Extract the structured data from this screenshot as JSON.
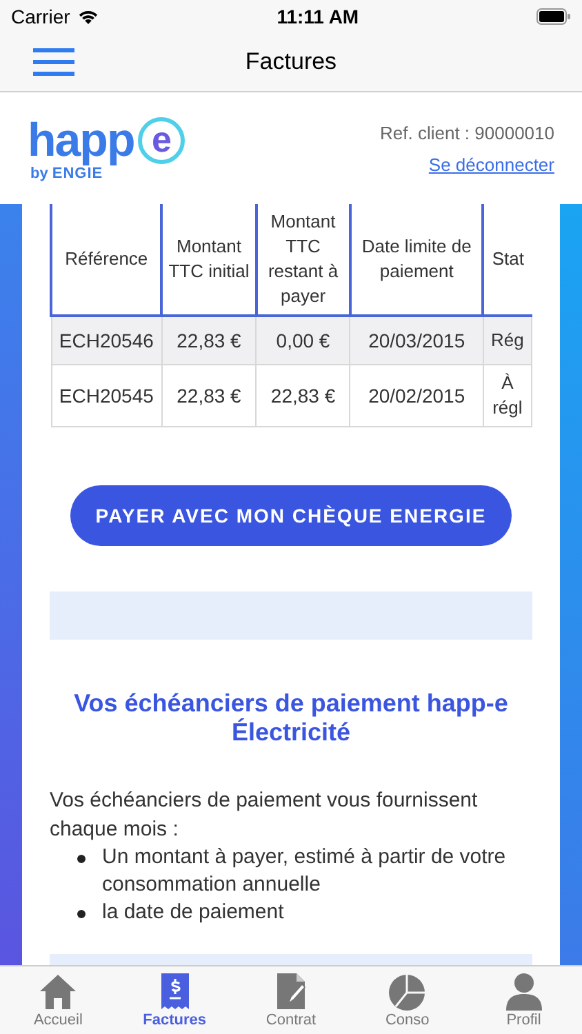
{
  "status_bar": {
    "carrier": "Carrier",
    "time": "11:11 AM"
  },
  "nav": {
    "title": "Factures"
  },
  "header": {
    "logo": {
      "word": "happ",
      "letter": "e",
      "by": "by",
      "brand": "ENGIE"
    },
    "client_ref": "Ref. client : 90000010",
    "logout": "Se déconnecter"
  },
  "table": {
    "columns": [
      "Référence",
      "Montant TTC initial",
      "Montant TTC restant à payer",
      "Date limite de paiement",
      "Stat"
    ],
    "rows": [
      {
        "cells": [
          "ECH20546",
          "22,83 €",
          "0,00 €",
          "20/03/2015",
          "Rég"
        ],
        "shaded": true
      },
      {
        "cells": [
          "ECH20545",
          "22,83 €",
          "22,83 €",
          "20/02/2015",
          "À régl"
        ],
        "shaded": false
      }
    ]
  },
  "pay_button": "PAYER AVEC MON CHÈQUE ENERGIE",
  "section": {
    "title": "Vos échéanciers de paiement happ-e Électricité",
    "intro": "Vos échéanciers de paiement vous fournissent chaque mois :",
    "bullets": [
      "Un montant à payer, estimé à partir de votre consommation annuelle",
      "la date de paiement"
    ]
  },
  "tabs": [
    {
      "label": "Accueil",
      "kind": "home",
      "selected": false
    },
    {
      "label": "Factures",
      "kind": "bill",
      "selected": true
    },
    {
      "label": "Contrat",
      "kind": "contract",
      "selected": false
    },
    {
      "label": "Conso",
      "kind": "chart",
      "selected": false
    },
    {
      "label": "Profil",
      "kind": "profile",
      "selected": false
    }
  ]
}
